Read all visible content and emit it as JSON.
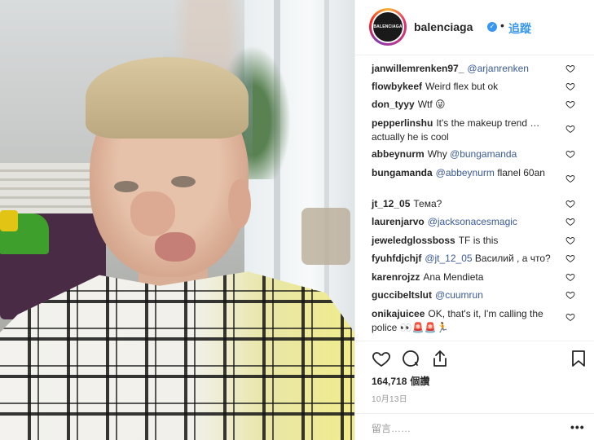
{
  "post": {
    "author": "balenciaga",
    "avatar_text": "BALENCIAGA",
    "verified_icon": "verified-badge-icon",
    "separator": "•",
    "follow_label": "追蹤"
  },
  "comments": [
    {
      "user": "janwillemrenken97_",
      "mention": "@arjanrenken",
      "text": ""
    },
    {
      "user": "flowbykeef",
      "mention": "",
      "text": "Weird flex but ok"
    },
    {
      "user": "don_tyyy",
      "mention": "",
      "text": "Wtf 😜"
    },
    {
      "user": "pepperlinshu",
      "mention": "",
      "text": "It's the makeup trend …actually he is cool"
    },
    {
      "user": "abbeynurm",
      "mention": "@bungamanda",
      "text": "Why"
    },
    {
      "user": "bungamanda",
      "mention": "@abbeynurm",
      "text": "flanel 60an"
    },
    {
      "user": "jt_12_05",
      "mention": "",
      "text": "Тема?"
    },
    {
      "user": "laurenjarvo",
      "mention": "@jacksonacesmagic",
      "text": ""
    },
    {
      "user": "jeweledglossboss",
      "mention": "",
      "text": "TF is this"
    },
    {
      "user": "fyuhfdjchjf",
      "mention": "@jt_12_05",
      "text": "Василий , а что?"
    },
    {
      "user": "karenrojzz",
      "mention": "",
      "text": "Ana Mendieta"
    },
    {
      "user": "guccibeltslut",
      "mention": "@cuumrun",
      "text": ""
    },
    {
      "user": "onikajuicee",
      "mention": "",
      "text": "OK, that's it, I'm calling the police 👀🚨🚨🏃"
    }
  ],
  "actions": {
    "like_icon": "heart-icon",
    "comment_icon": "comment-bubble-icon",
    "share_icon": "share-icon",
    "save_icon": "bookmark-icon"
  },
  "stats": {
    "likes_count": "164,718",
    "likes_label": "個讚",
    "date": "10月13日"
  },
  "comment_box": {
    "placeholder": "留言……",
    "more_label": "•••"
  },
  "colors": {
    "accent": "#3897f0",
    "mention": "#3b5998",
    "text": "#262626",
    "muted": "#999999"
  }
}
